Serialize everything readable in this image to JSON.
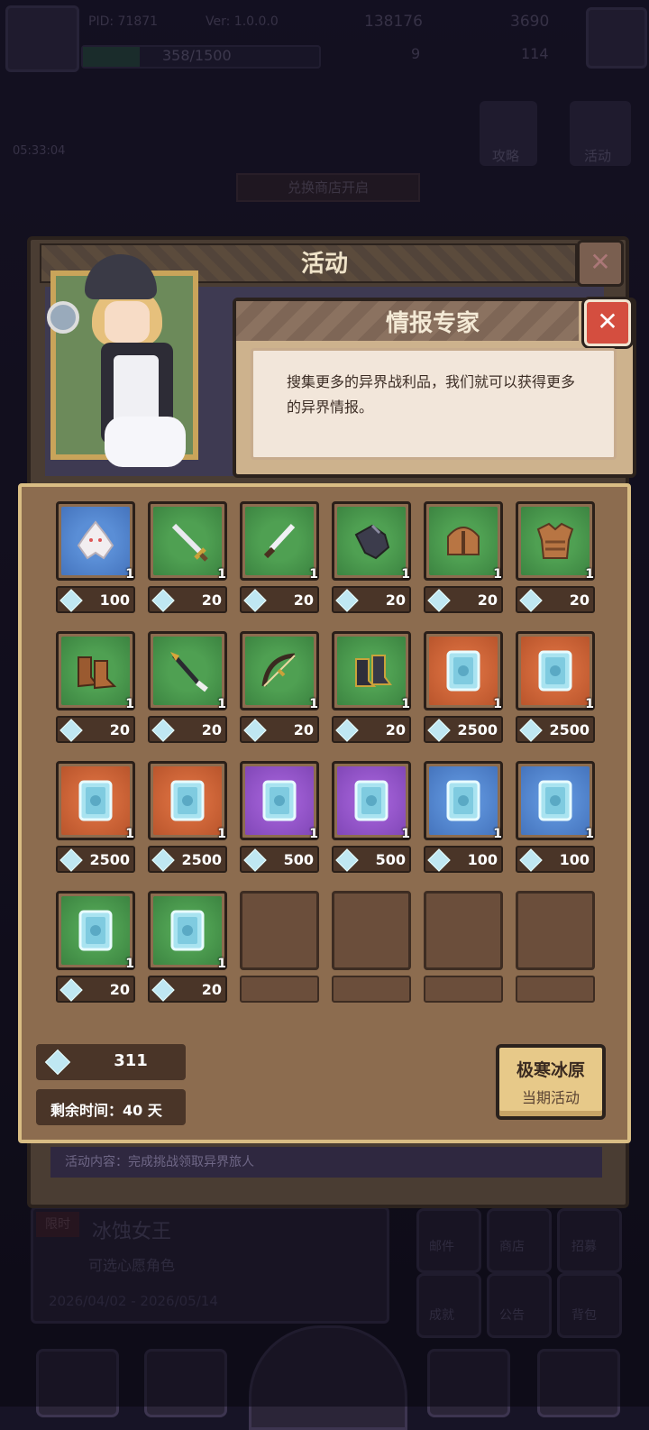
{
  "topbar": {
    "pid": "PID: 71871",
    "version": "Ver: 1.0.0.0",
    "coins": "138176",
    "gems": "3690",
    "level_progress_text": "358/1500",
    "level_progress_fraction": 0.2387,
    "stat_a": "9",
    "stat_b": "114"
  },
  "background": {
    "timer": "05:33:04",
    "guide_label": "攻略",
    "activity_label": "活动",
    "shop_open_label": "兑换商店开启",
    "event_badge": "限时",
    "event_name": "冰蚀女王",
    "event_sub": "可选心愿角色",
    "event_dates": "2026/04/02 - 2026/05/14",
    "side_buttons": [
      "邮件",
      "商店",
      "招募",
      "成就",
      "公告",
      "背包"
    ]
  },
  "panel": {
    "title": "活动",
    "close_symbol": "✕",
    "footer_text": "活动内容：完成挑战领取异界旅人"
  },
  "dialog": {
    "title": "情报专家",
    "close_symbol": "✕",
    "text": "搜集更多的异界战利品，我们就可以获得更多的异界情报。"
  },
  "shop": {
    "items": [
      {
        "icon": "white-dragon-icon",
        "rarity": "blue",
        "qty": "1",
        "price": "100"
      },
      {
        "icon": "sword-icon",
        "rarity": "green",
        "qty": "1",
        "price": "20"
      },
      {
        "icon": "dagger-icon",
        "rarity": "green",
        "qty": "1",
        "price": "20"
      },
      {
        "icon": "gauntlet-icon",
        "rarity": "green",
        "qty": "1",
        "price": "20"
      },
      {
        "icon": "helmet-icon",
        "rarity": "green",
        "qty": "1",
        "price": "20"
      },
      {
        "icon": "armor-icon",
        "rarity": "green",
        "qty": "1",
        "price": "20"
      },
      {
        "icon": "boots-icon",
        "rarity": "green",
        "qty": "1",
        "price": "20"
      },
      {
        "icon": "spear-icon",
        "rarity": "green",
        "qty": "1",
        "price": "20"
      },
      {
        "icon": "bow-icon",
        "rarity": "green",
        "qty": "1",
        "price": "20"
      },
      {
        "icon": "greaves-icon",
        "rarity": "green",
        "qty": "1",
        "price": "20"
      },
      {
        "icon": "rune-card-icon",
        "rarity": "orange",
        "qty": "1",
        "price": "2500"
      },
      {
        "icon": "rune-card-icon",
        "rarity": "orange",
        "qty": "1",
        "price": "2500"
      },
      {
        "icon": "rune-card-icon",
        "rarity": "orange",
        "qty": "1",
        "price": "2500"
      },
      {
        "icon": "rune-card-icon",
        "rarity": "orange",
        "qty": "1",
        "price": "2500"
      },
      {
        "icon": "rune-card-icon",
        "rarity": "purple",
        "qty": "1",
        "price": "500"
      },
      {
        "icon": "rune-card-icon",
        "rarity": "purple",
        "qty": "1",
        "price": "500"
      },
      {
        "icon": "rune-card-icon",
        "rarity": "blue",
        "qty": "1",
        "price": "100"
      },
      {
        "icon": "rune-card-icon",
        "rarity": "blue",
        "qty": "1",
        "price": "100"
      },
      {
        "icon": "rune-card-icon",
        "rarity": "green",
        "qty": "1",
        "price": "20"
      },
      {
        "icon": "rune-card-icon",
        "rarity": "green",
        "qty": "1",
        "price": "20"
      }
    ],
    "empty_slots": 4,
    "currency_amount": "311",
    "time_left": "剩余时间：40 天",
    "event_button_title": "极寒冰原",
    "event_button_sub": "当期活动"
  },
  "colors": {
    "green": "#4fa052",
    "blue": "#5a8ed6",
    "orange": "#d46a3c",
    "purple": "#9b5bd0"
  }
}
